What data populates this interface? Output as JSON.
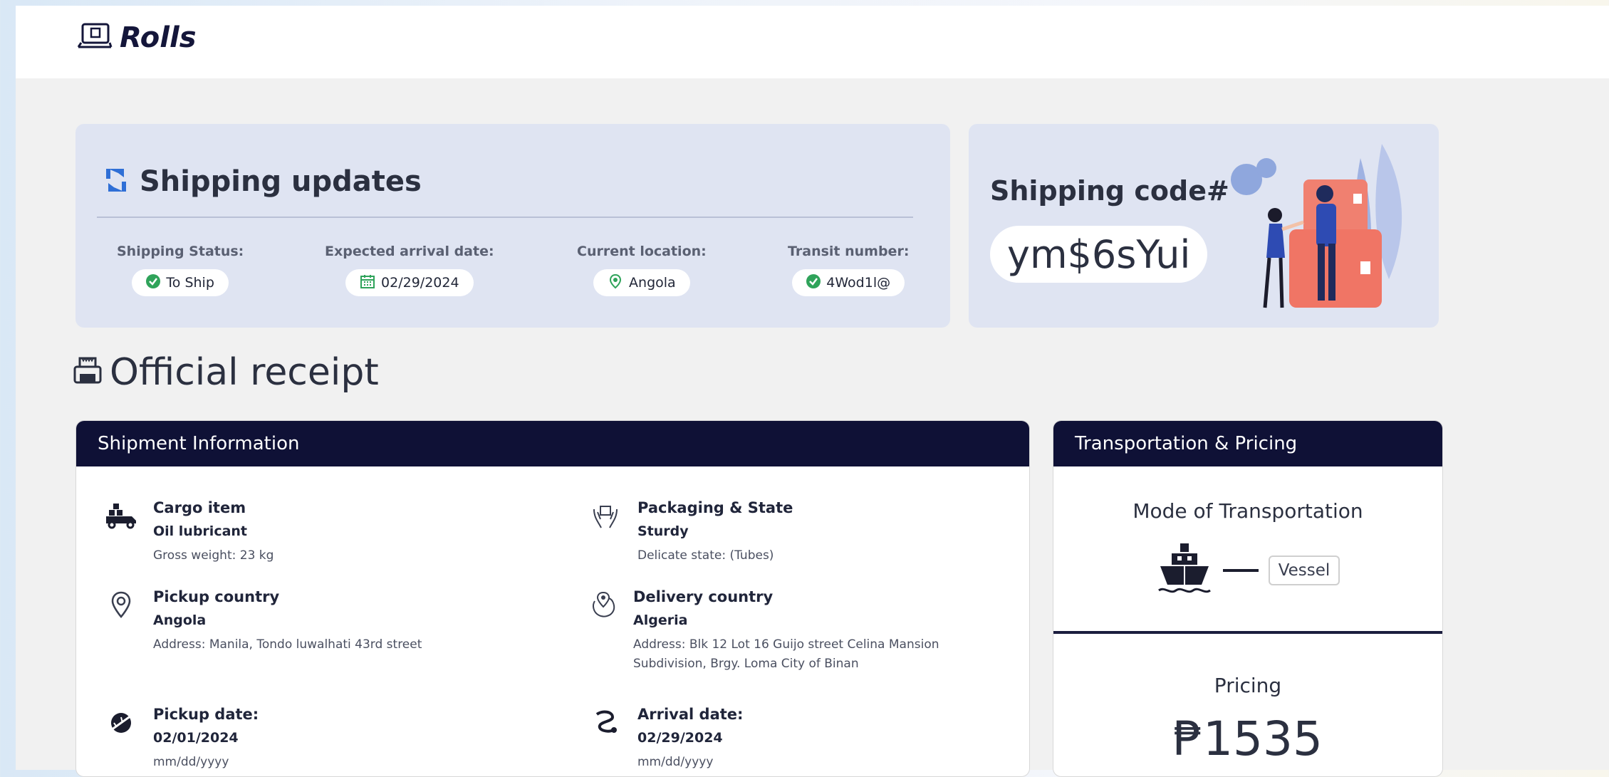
{
  "app": {
    "name": "Rolls"
  },
  "shipping_updates": {
    "title": "Shipping updates",
    "stats": [
      {
        "label": "Shipping Status:",
        "value": "To Ship",
        "icon": "check-circle-icon"
      },
      {
        "label": "Expected arrival date:",
        "value": "02/29/2024",
        "icon": "calendar-icon"
      },
      {
        "label": "Current location:",
        "value": "Angola",
        "icon": "location-icon"
      },
      {
        "label": "Transit number:",
        "value": "4Wod1l@",
        "icon": "check-circle-icon"
      }
    ]
  },
  "shipping_code": {
    "title": "Shipping code#",
    "value": "ym$6sYui"
  },
  "receipt": {
    "title": "Official receipt"
  },
  "shipment_info": {
    "header": "Shipment Information",
    "cargo": {
      "label": "Cargo item",
      "value": "Oil lubricant",
      "sub": "Gross weight: 23 kg"
    },
    "packaging": {
      "label": "Packaging & State",
      "value": "Sturdy",
      "sub": "Delicate state: (Tubes)"
    },
    "pickup_country": {
      "label": "Pickup country",
      "value": "Angola",
      "sub": "Address: Manila, Tondo luwalhati 43rd street"
    },
    "delivery_country": {
      "label": "Delivery country",
      "value": "Algeria",
      "sub": "Address: Blk 12 Lot 16 Guijo street Celina Mansion Subdivision, Brgy. Loma City of Binan"
    },
    "pickup_date": {
      "label": "Pickup date:",
      "value": "02/01/2024",
      "sub": "mm/dd/yyyy"
    },
    "arrival_date": {
      "label": "Arrival date:",
      "value": "02/29/2024",
      "sub": "mm/dd/yyyy"
    }
  },
  "pricing_panel": {
    "header": "Transportation & Pricing",
    "mode_title": "Mode of Transportation",
    "mode_value": "Vessel",
    "pricing_title": "Pricing",
    "pricing_value": "₱1535"
  },
  "colors": {
    "navy": "#0f1136",
    "card": "#dfe4f2",
    "status_green": "#2fa35a",
    "accent_blue": "#2f6fd6"
  }
}
